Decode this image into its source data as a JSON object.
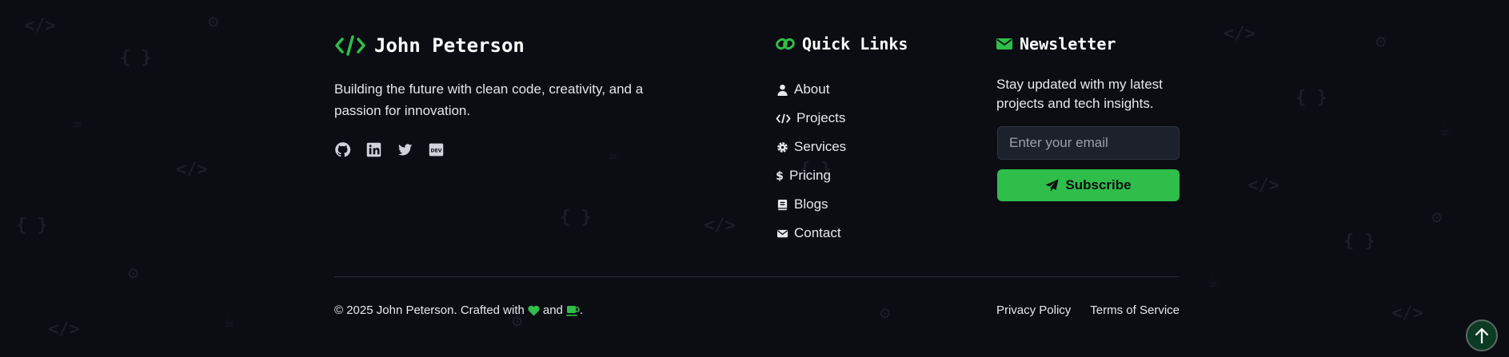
{
  "brand": {
    "name": "John Peterson",
    "icon": "code-icon"
  },
  "tagline": "Building the future with clean code, creativity, and a passion for innovation.",
  "socials": [
    {
      "name": "github-icon"
    },
    {
      "name": "linkedin-icon"
    },
    {
      "name": "twitter-icon"
    },
    {
      "name": "dev-icon",
      "text": "DEV"
    }
  ],
  "quick_links": {
    "title": "Quick Links",
    "items": [
      {
        "label": "About",
        "icon": "user-icon"
      },
      {
        "label": "Projects",
        "icon": "code-icon"
      },
      {
        "label": "Services",
        "icon": "gear-icon"
      },
      {
        "label": "Pricing",
        "icon": "dollar-icon"
      },
      {
        "label": "Blogs",
        "icon": "book-icon"
      },
      {
        "label": "Contact",
        "icon": "envelope-icon"
      }
    ]
  },
  "newsletter": {
    "title": "Newsletter",
    "text": "Stay updated with my latest projects and tech insights.",
    "placeholder": "Enter your email",
    "button": "Subscribe"
  },
  "bottom": {
    "copyright_prefix": "© 2025 John Peterson. Crafted with",
    "and": "and",
    "period": ".",
    "privacy": "Privacy Policy",
    "terms": "Terms of Service"
  },
  "colors": {
    "accent": "#2fbe4a",
    "background": "#0b0d12",
    "text": "#e6e8ec"
  }
}
